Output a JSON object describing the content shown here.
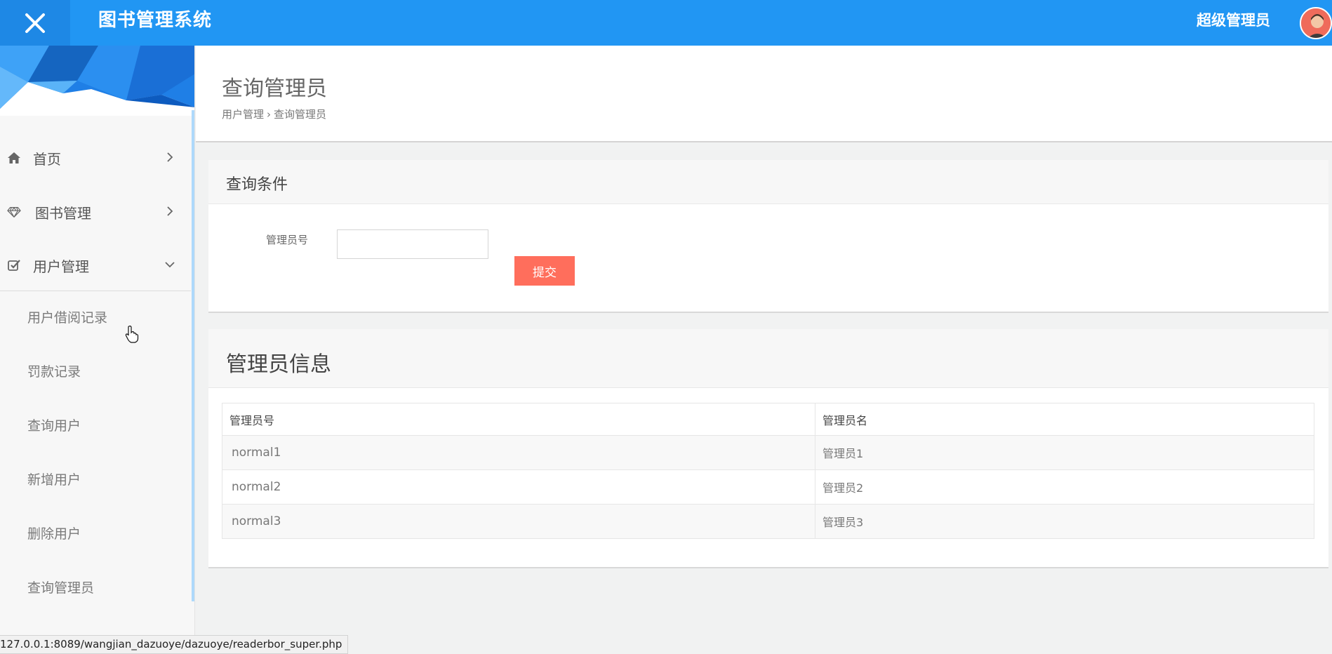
{
  "header": {
    "title": "图书管理系统",
    "user_name": "超级管理员"
  },
  "colors": {
    "topbar": "#2196f3",
    "accent_button": "#ff6e5c"
  },
  "sidebar": {
    "items": [
      {
        "label": "首页",
        "icon": "home-icon",
        "expanded": false
      },
      {
        "label": "图书管理",
        "icon": "diamond-icon",
        "expanded": false
      },
      {
        "label": "用户管理",
        "icon": "check-square-icon",
        "expanded": true
      }
    ],
    "sub_items": [
      {
        "label": "用户借阅记录"
      },
      {
        "label": "罚款记录"
      },
      {
        "label": "查询用户"
      },
      {
        "label": "新增用户"
      },
      {
        "label": "删除用户"
      },
      {
        "label": "查询管理员"
      }
    ]
  },
  "page": {
    "title": "查询管理员",
    "breadcrumb": [
      "用户管理",
      "查询管理员"
    ],
    "breadcrumb_sep": "›"
  },
  "query_panel": {
    "title": "查询条件",
    "field_label": "管理员号",
    "field_value": "",
    "submit_label": "提交"
  },
  "result_panel": {
    "title": "管理员信息",
    "columns": [
      "管理员号",
      "管理员名"
    ],
    "rows": [
      [
        "normal1",
        "管理员1"
      ],
      [
        "normal2",
        "管理员2"
      ],
      [
        "normal3",
        "管理员3"
      ]
    ]
  },
  "status_bar": {
    "url": "127.0.0.1:8089/wangjian_dazuoye/dazuoye/readerbor_super.php"
  }
}
